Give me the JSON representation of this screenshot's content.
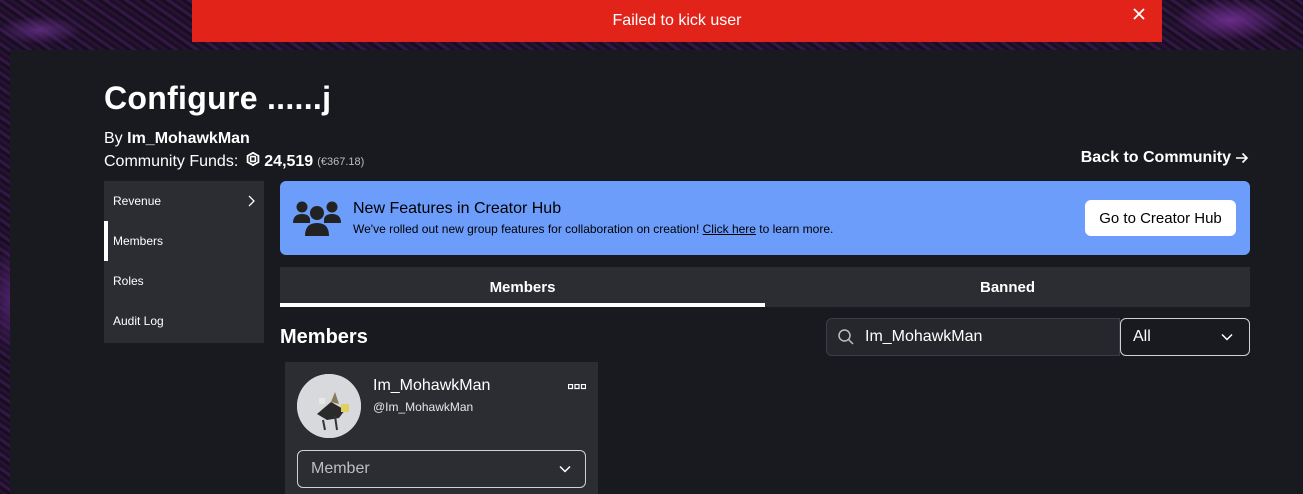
{
  "toast": {
    "message": "Failed to kick user"
  },
  "header": {
    "title": "Configure ......j",
    "by_prefix": "By",
    "owner": "Im_MohawkMan",
    "funds_label": "Community Funds:",
    "funds_amount": "24,519",
    "funds_eur": "(€367.18)",
    "back_link": "Back to Community"
  },
  "sidebar": {
    "items": [
      {
        "label": "Revenue"
      },
      {
        "label": "Members"
      },
      {
        "label": "Roles"
      },
      {
        "label": "Audit Log"
      }
    ]
  },
  "banner": {
    "title": "New Features in Creator Hub",
    "text_before": "We've rolled out new group features for collaboration on creation! ",
    "link": "Click here",
    "text_after": " to learn more.",
    "button": "Go to Creator Hub"
  },
  "tabs": [
    {
      "label": "Members"
    },
    {
      "label": "Banned"
    }
  ],
  "members": {
    "title": "Members",
    "search_value": "Im_MohawkMan",
    "filter_value": "All",
    "list": [
      {
        "name": "Im_MohawkMan",
        "handle": "@Im_MohawkMan",
        "role": "Member"
      }
    ]
  },
  "colors": {
    "toast": "#e2231a",
    "banner": "#6c9dfa",
    "panel": "#191a1f",
    "surface": "#2b2d33"
  }
}
